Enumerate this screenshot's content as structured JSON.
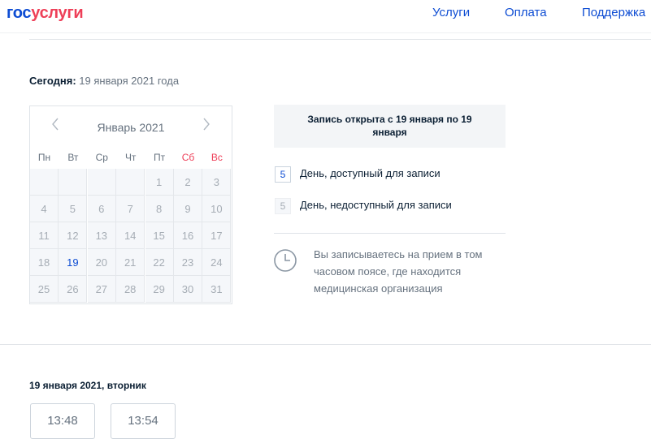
{
  "header": {
    "logo_part1": "гос",
    "logo_part2": "услуги",
    "nav": [
      "Услуги",
      "Оплата",
      "Поддержка"
    ]
  },
  "today": {
    "label": "Сегодня:",
    "value": "19 января 2021 года"
  },
  "calendar": {
    "month": "Январь 2021",
    "prev_icon": "chevron-left-icon",
    "next_icon": "chevron-right-icon",
    "weekdays": [
      "Пн",
      "Вт",
      "Ср",
      "Чт",
      "Пт",
      "Сб",
      "Вс"
    ],
    "weeks": [
      [
        "",
        "",
        "",
        "",
        "1",
        "2",
        "3"
      ],
      [
        "4",
        "5",
        "6",
        "7",
        "8",
        "9",
        "10"
      ],
      [
        "11",
        "12",
        "13",
        "14",
        "15",
        "16",
        "17"
      ],
      [
        "18",
        "19",
        "20",
        "21",
        "22",
        "23",
        "24"
      ],
      [
        "25",
        "26",
        "27",
        "28",
        "29",
        "30",
        "31"
      ]
    ],
    "available_day": "19"
  },
  "notice": "Запись открыта с 19 января по 19 января",
  "legend": [
    {
      "box": "5",
      "text": "День, доступный для записи"
    },
    {
      "box": "5",
      "text": "День, недоступный для записи"
    }
  ],
  "timezone_note": "Вы записываетесь на прием в том часовом поясе, где находится медицинская организация",
  "slots": {
    "date_title": "19 января 2021, вторник",
    "times": [
      "13:48",
      "13:54"
    ]
  },
  "colors": {
    "brand_blue": "#0d4cd3",
    "brand_red": "#ee3f58",
    "weekend": "#ee3f58"
  }
}
